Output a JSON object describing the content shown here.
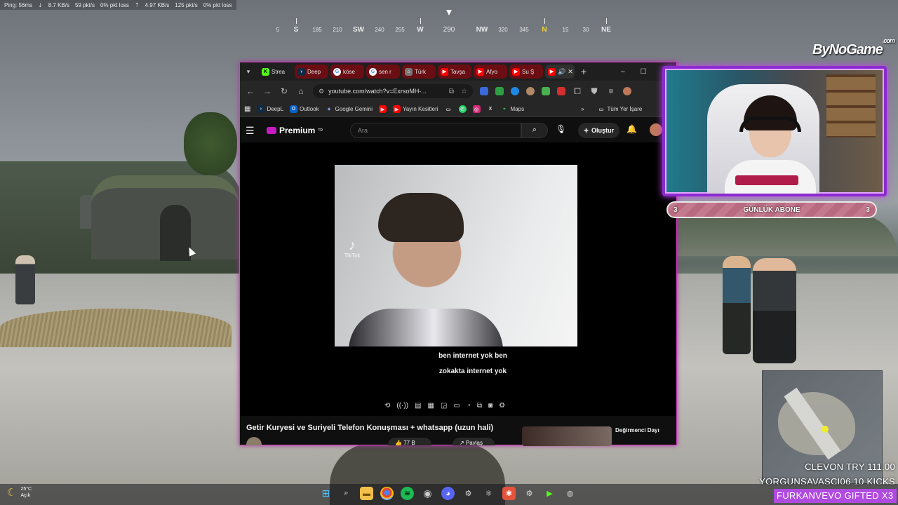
{
  "hud": {
    "ping": "Ping: 56ms",
    "down_rate": "8.7 KB/s",
    "down_pkts": "59 pkt/s",
    "down_loss": "0% pkt loss",
    "up_rate": "4.97 KB/s",
    "up_pkts": "125 pkt/s",
    "up_loss": "0% pkt loss"
  },
  "compass": {
    "marks": [
      "5",
      "S",
      "185",
      "210",
      "SW",
      "240",
      "255",
      "W",
      "290",
      "NW",
      "320",
      "345",
      "N",
      "15",
      "30",
      "NE"
    ],
    "heading": "290"
  },
  "browser": {
    "tabs": [
      {
        "label": "Strea",
        "icon": "kick-icon",
        "color": "#53fc18"
      },
      {
        "label": "Deep",
        "icon": "deepl-icon",
        "color": "#0f2b46"
      },
      {
        "label": "köse",
        "icon": "google-icon",
        "color": "#4285f4"
      },
      {
        "label": "sen r",
        "icon": "google-icon",
        "color": "#4285f4"
      },
      {
        "label": "Türk",
        "icon": "page-icon",
        "color": "#888888"
      },
      {
        "label": "Tavşa",
        "icon": "youtube-icon",
        "color": "#ff0000"
      },
      {
        "label": "Afyo",
        "icon": "youtube-icon",
        "color": "#ff0000"
      },
      {
        "label": "Su Ş",
        "icon": "youtube-icon",
        "color": "#ff0000"
      },
      {
        "label": "",
        "icon": "youtube-icon",
        "color": "#ff0000"
      }
    ],
    "url": "youtube.com/watch?v=ExrsoMH-...",
    "bookmarks": [
      {
        "label": "DeepL",
        "icon": "deepl-icon"
      },
      {
        "label": "Outlook",
        "icon": "outlook-icon"
      },
      {
        "label": "Google Gemini",
        "icon": "gemini-icon"
      },
      {
        "label": "",
        "icon": "youtube-icon"
      },
      {
        "label": "Yayın Kesitleri",
        "icon": "youtube-icon"
      },
      {
        "label": "",
        "icon": "folder-icon"
      },
      {
        "label": "",
        "icon": "whatsapp-icon"
      },
      {
        "label": "",
        "icon": "instagram-icon"
      },
      {
        "label": "",
        "icon": "x-icon"
      },
      {
        "label": "Maps",
        "icon": "maps-icon"
      }
    ],
    "bookmarks_folder": "Tüm Yer İşare"
  },
  "youtube": {
    "logo": "Premium",
    "logo_sup": "TR",
    "search_placeholder": "Ara",
    "create_label": "Oluştur",
    "caption_line1": "ben internet yok ben",
    "caption_line2": "zokakta internet yok",
    "tiktok_label": "TikTok",
    "video_title": "Getir Kuryesi ve Suriyeli Telefon Konuşması + whatsapp (uzun hali)",
    "like_count": "77 B",
    "share_label": "Paylaş",
    "rec_title": "Değirmenci Dayı"
  },
  "overlay": {
    "brand": "ByNoGame",
    "brand_sup": ".com",
    "sub_left": "3",
    "sub_label": "GÜNLÜK ABONE",
    "sub_right": "3"
  },
  "kick_feed": [
    "CLEVON  TRY 111.00",
    "YORGUNSAVASCI06  10 KICKS"
  ],
  "gift_line": "FURKANVEVO  GIFTED X3",
  "taskbar": {
    "temp": "25°C",
    "weather": "Açık"
  }
}
